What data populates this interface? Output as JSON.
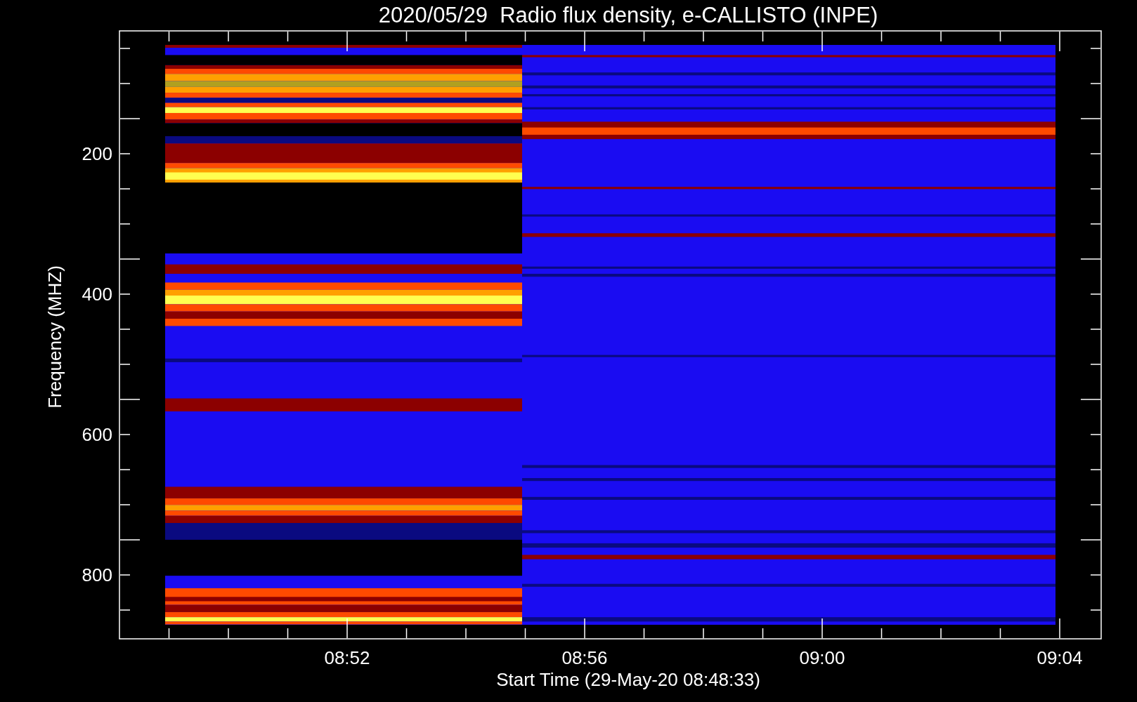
{
  "title": "2020/05/29  Radio flux density, e-CALLISTO (INPE)",
  "y_axis": {
    "label": "Frequency (MHZ)",
    "ticks": [
      "200",
      "400",
      "600",
      "800"
    ]
  },
  "x_axis": {
    "label": "Start Time (29-May-20 08:48:33)",
    "ticks": [
      "08:52",
      "08:56",
      "09:00",
      "09:04"
    ]
  }
}
